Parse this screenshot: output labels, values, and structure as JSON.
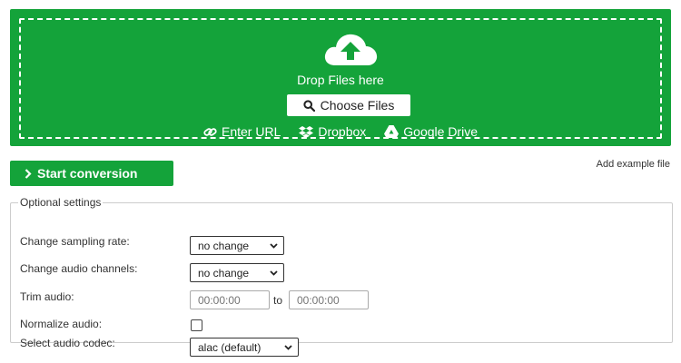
{
  "upload": {
    "drop_label": "Drop Files here",
    "choose_label": "Choose Files",
    "sources": [
      {
        "label": "Enter URL",
        "icon": "link-icon"
      },
      {
        "label": "Dropbox",
        "icon": "dropbox-icon"
      },
      {
        "label": "Google Drive",
        "icon": "google-drive-icon"
      }
    ],
    "icon": "cloud-upload-icon"
  },
  "actions": {
    "start_label": "Start conversion",
    "example_label": "Add example file"
  },
  "settings": {
    "legend": "Optional settings",
    "sampling_rate": {
      "label": "Change sampling rate:",
      "value": "no change"
    },
    "audio_channels": {
      "label": "Change audio channels:",
      "value": "no change"
    },
    "trim": {
      "label": "Trim audio:",
      "from_placeholder": "00:00:00",
      "to_label": "to",
      "to_placeholder": "00:00:00"
    },
    "normalize": {
      "label": "Normalize audio:",
      "checked": false
    },
    "codec": {
      "label": "Select audio codec:",
      "value": "alac (default)"
    }
  },
  "colors": {
    "brand_green": "#14a33a",
    "white": "#ffffff"
  }
}
